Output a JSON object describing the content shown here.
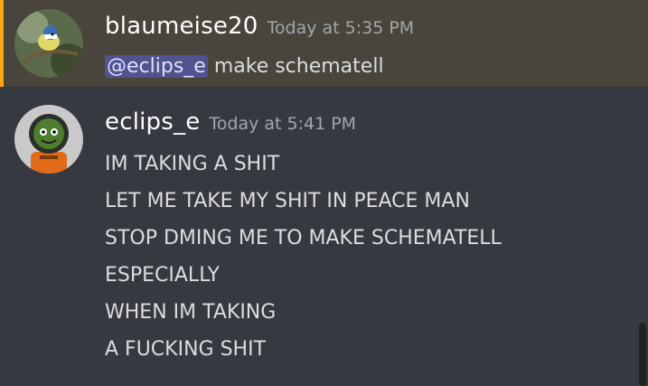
{
  "messages": [
    {
      "username": "blaumeise20",
      "timestamp": "Today at 5:35 PM",
      "mention": "@eclips_e",
      "text": " make schematell",
      "avatar_icon": "bird-photo-avatar-icon"
    },
    {
      "username": "eclips_e",
      "timestamp": "Today at 5:41 PM",
      "avatar_icon": "astronaut-avatar-icon",
      "lines": [
        "IM TAKING A SHIT",
        "LET ME TAKE MY SHIT IN PEACE MAN",
        "STOP DMING ME TO MAKE SCHEMATELL",
        "ESPECIALLY",
        "WHEN IM TAKING",
        "A FUCKING SHIT"
      ]
    }
  ],
  "colors": {
    "background": "#36393f",
    "mention_highlight_bg": "#49443c",
    "mention_bar": "#faa81a",
    "username": "#ffffff",
    "timestamp": "#a3a6aa",
    "text": "#dcddde"
  }
}
